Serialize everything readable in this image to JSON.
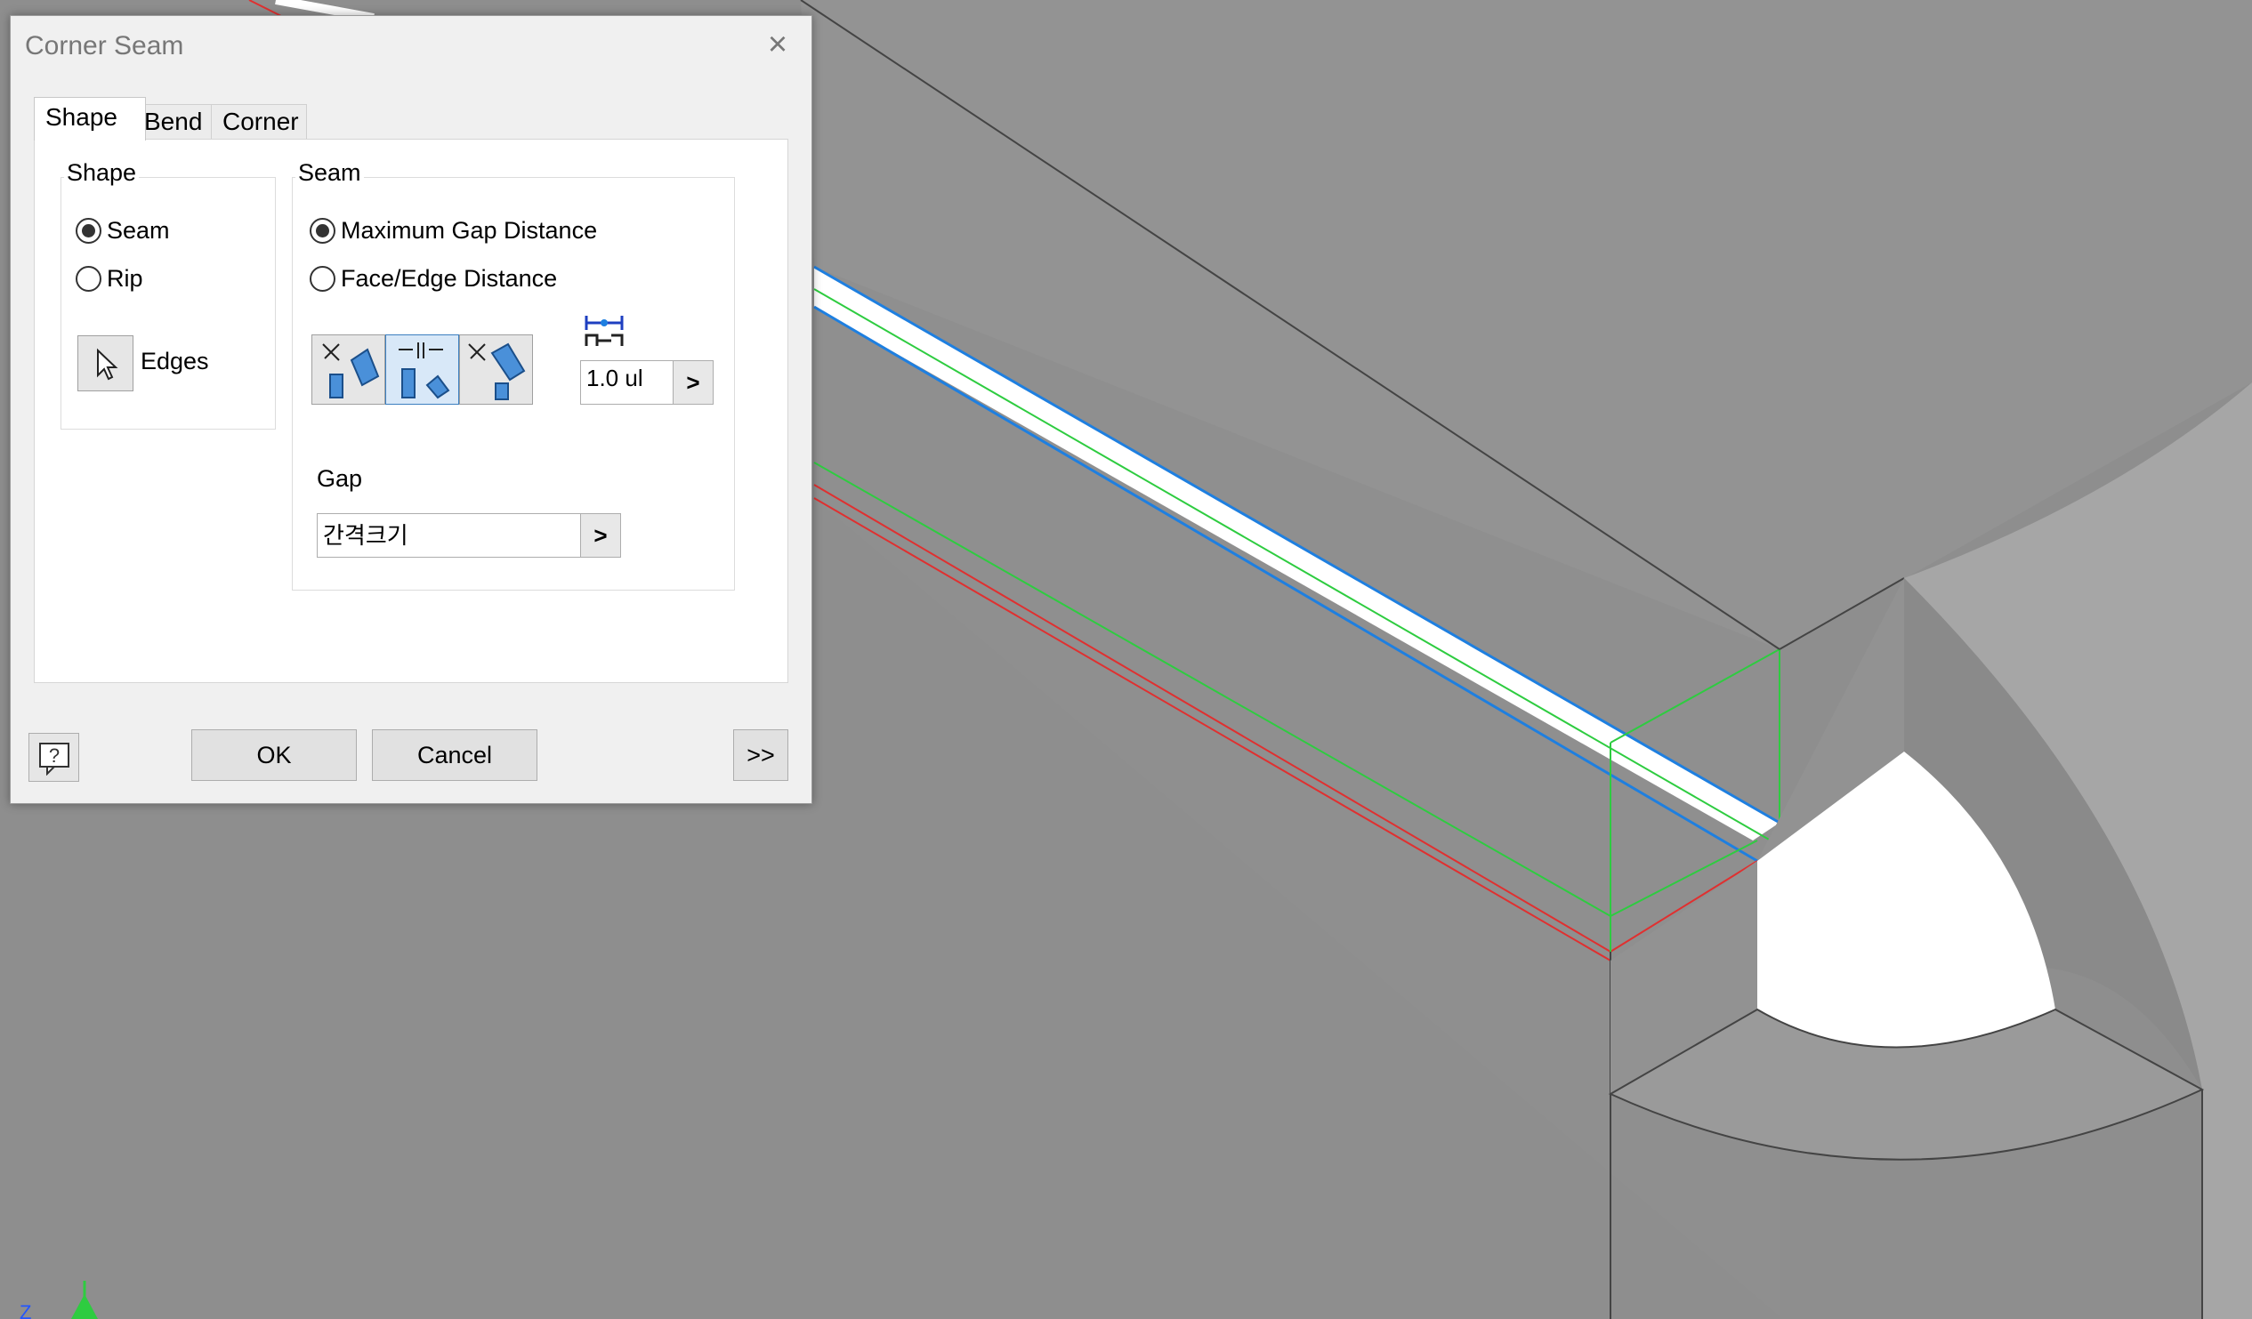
{
  "dialog": {
    "title": "Corner Seam",
    "tabs": [
      "Shape",
      "Bend",
      "Corner"
    ],
    "shape_group": {
      "label": "Shape",
      "options": [
        "Seam",
        "Rip"
      ],
      "selected": "Seam",
      "edges_label": "Edges"
    },
    "seam_group": {
      "label": "Seam",
      "options": [
        "Maximum Gap Distance",
        "Face/Edge Distance"
      ],
      "selected": "Maximum Gap Distance",
      "overlap_value": "1.0 ul"
    },
    "gap": {
      "label": "Gap",
      "value": "간격크기"
    },
    "buttons": {
      "ok": "OK",
      "cancel": "Cancel",
      "more": ">>"
    }
  },
  "colors": {
    "viewport_bg": "#8c8c8c",
    "highlight_blue": "#1e7fe0",
    "edge_green": "#2ecc40",
    "edge_red": "#e03030"
  }
}
